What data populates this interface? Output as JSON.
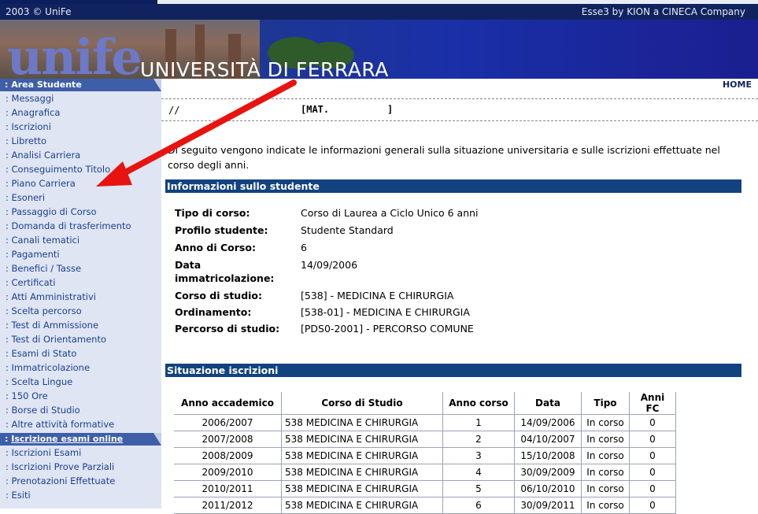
{
  "header": {
    "copyright": "2003 © UniFe",
    "vendor": "Esse3 by KION a CINECA Company",
    "logo": "unife",
    "university": "UNIVERSITÀ DI FERRARA",
    "home": "HOME"
  },
  "sidebar": {
    "area_title": ": Area Studente",
    "items": [
      ": Messaggi",
      ": Anagrafica",
      ": Iscrizioni",
      ": Libretto",
      ": Analisi Carriera",
      ": Conseguimento Titolo",
      ": Piano Carriera",
      ": Esoneri",
      ": Passaggio di Corso",
      ": Domanda di trasferimento",
      ": Canali tematici",
      ": Pagamenti",
      ": Benefici / Tasse",
      ": Certificati",
      ": Atti Amministrativi",
      ": Scelta percorso",
      ": Test di Ammissione",
      ": Test di Orientamento",
      ": Esami di Stato",
      ": Immatricolazione",
      ": Scelta Lingue",
      ": 150 Ore",
      ": Borse di Studio",
      ": Altre attività formative"
    ],
    "exam_title": "Iscrizione esami online",
    "exam_prefix": ": ",
    "exam_items": [
      ": Iscrizioni Esami",
      ": Iscrizioni Prove Parziali",
      ": Prenotazioni Effettuate",
      ": Esiti"
    ]
  },
  "student": {
    "slashes": "//",
    "mat_label": "[MAT.",
    "mat_close": "]"
  },
  "intro": "Di seguito vengono indicate le informazioni generali sulla situazione universitaria e sulle iscrizioni effettuate nel corso degli anni.",
  "info_section": "Informazioni sullo studente",
  "info": {
    "tipo_label": "Tipo di corso:",
    "tipo": "Corso di Laurea a Ciclo Unico 6 anni",
    "profilo_label": "Profilo studente:",
    "profilo": "Studente Standard",
    "anno_label": "Anno di Corso:",
    "anno": "6",
    "data_label1": "Data",
    "data_label2": "immatricolazione:",
    "data": "14/09/2006",
    "corso_label": "Corso di studio:",
    "corso": "[538] - MEDICINA E CHIRURGIA",
    "ord_label": "Ordinamento:",
    "ord": "[538-01] - MEDICINA E CHIRURGIA",
    "perc_label": "Percorso di studio:",
    "perc": "[PDS0-2001] - PERCORSO COMUNE"
  },
  "iscr_section": "Situazione iscrizioni",
  "table": {
    "headers": [
      "Anno accademico",
      "Corso di Studio",
      "Anno corso",
      "Data",
      "Tipo",
      "Anni FC"
    ],
    "rows": [
      [
        "2006/2007",
        "538 MEDICINA E CHIRURGIA",
        "1",
        "14/09/2006",
        "In corso",
        "0"
      ],
      [
        "2007/2008",
        "538 MEDICINA E CHIRURGIA",
        "2",
        "04/10/2007",
        "In corso",
        "0"
      ],
      [
        "2008/2009",
        "538 MEDICINA E CHIRURGIA",
        "3",
        "15/10/2008",
        "In corso",
        "0"
      ],
      [
        "2009/2010",
        "538 MEDICINA E CHIRURGIA",
        "4",
        "30/09/2009",
        "In corso",
        "0"
      ],
      [
        "2010/2011",
        "538 MEDICINA E CHIRURGIA",
        "5",
        "06/10/2010",
        "In corso",
        "0"
      ],
      [
        "2011/2012",
        "538 MEDICINA E CHIRURGIA",
        "6",
        "30/09/2011",
        "In corso",
        "0"
      ]
    ]
  },
  "annotation_color": "#e8130f"
}
